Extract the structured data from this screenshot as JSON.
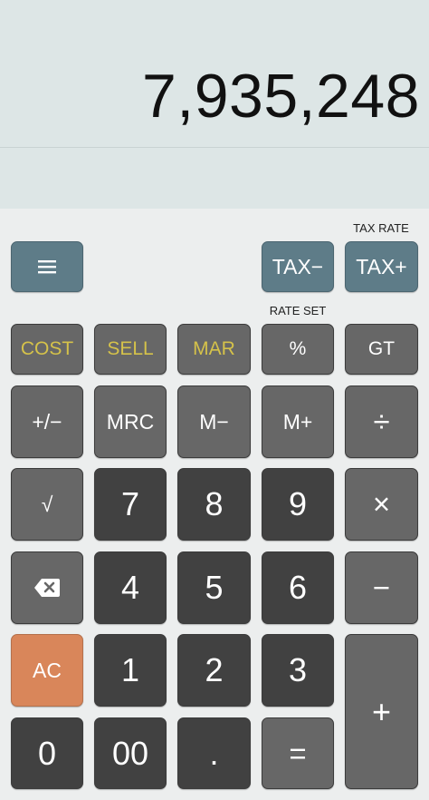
{
  "display": {
    "value": "7,935,248"
  },
  "captions": {
    "tax_rate": "TAX RATE",
    "rate_set": "RATE SET"
  },
  "keys": {
    "menu": "menu-icon",
    "tax_minus": "TAX−",
    "tax_plus": "TAX+",
    "cost": "COST",
    "sell": "SELL",
    "mar": "MAR",
    "percent": "%",
    "gt": "GT",
    "plus_minus": "+/−",
    "mrc": "MRC",
    "m_minus": "M−",
    "m_plus": "M+",
    "divide": "÷",
    "sqrt": "√",
    "seven": "7",
    "eight": "8",
    "nine": "9",
    "multiply": "×",
    "backspace": "backspace-icon",
    "four": "4",
    "five": "5",
    "six": "6",
    "minus": "−",
    "ac": "AC",
    "one": "1",
    "two": "2",
    "three": "3",
    "plus": "+",
    "zero": "0",
    "double_zero": "00",
    "dot": ".",
    "equals": "="
  },
  "colors": {
    "display_bg": "#dde6e6",
    "blue_key": "#5e7c88",
    "gray_key": "#676767",
    "dark_key": "#414141",
    "orange_key": "#d9865a",
    "gold_text": "#d5c24a"
  }
}
